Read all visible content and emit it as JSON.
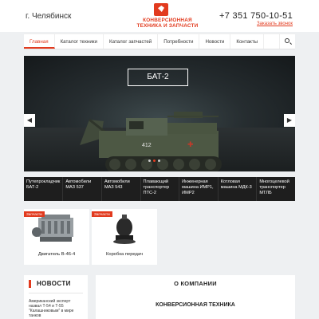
{
  "header": {
    "city": "г. Челябинск",
    "logo_line1": "КОНВЕРСИОННАЯ",
    "logo_line2": "ТЕХНИКА И ЗАПЧАСТИ",
    "phone": "+7 351 750-10-51",
    "callback": "Заказать звонок"
  },
  "nav": {
    "items": [
      {
        "label": "Главная",
        "active": true
      },
      {
        "label": "Каталог техники"
      },
      {
        "label": "Каталог запчастей"
      },
      {
        "label": "Потребности"
      },
      {
        "label": "Новости"
      },
      {
        "label": "Контакты"
      }
    ],
    "search_icon": "search-icon"
  },
  "hero": {
    "title": "БАТ-2",
    "vehicle_number": "412",
    "prev_icon": "chevron-left-icon",
    "next_icon": "chevron-right-icon",
    "active_slide": 2,
    "slide_count": 3
  },
  "categories": [
    {
      "line1": "Путепрокладчик",
      "line2": "БАТ-2"
    },
    {
      "line1": "Автомобили",
      "line2": "МАЗ 537"
    },
    {
      "line1": "Автомобили",
      "line2": "МАЗ 543"
    },
    {
      "line1": "Плавающий",
      "line2": "транспортер",
      "line3": "ПТС-2"
    },
    {
      "line1": "Инженерная",
      "line2": "машина ИМР1,",
      "line3": "ИМР2"
    },
    {
      "line1": "Котловая",
      "line2": "машина МДК-3"
    },
    {
      "line1": "Многоцелевой",
      "line2": "транспортер",
      "line3": "МТЛБ"
    }
  ],
  "products": [
    {
      "badge": "Запчасти",
      "name": "Двигатель В-46-4"
    },
    {
      "badge": "Запчасти",
      "name": "Коробка передач"
    }
  ],
  "news": {
    "title": "НОВОСТИ",
    "item_line1": "Американский эксперт",
    "item_line2": "назвал Т-54 и Т-55",
    "item_line3": "\"Калашниковым\" в мире",
    "item_line4": "танков"
  },
  "about": {
    "title": "О КОМПАНИИ",
    "subtitle": "КОНВЕРСИОННАЯ ТЕХНИКА"
  },
  "colors": {
    "accent": "#e23a1e",
    "category_bar": "#1e1e1e",
    "page_bg": "#eef0f2"
  }
}
